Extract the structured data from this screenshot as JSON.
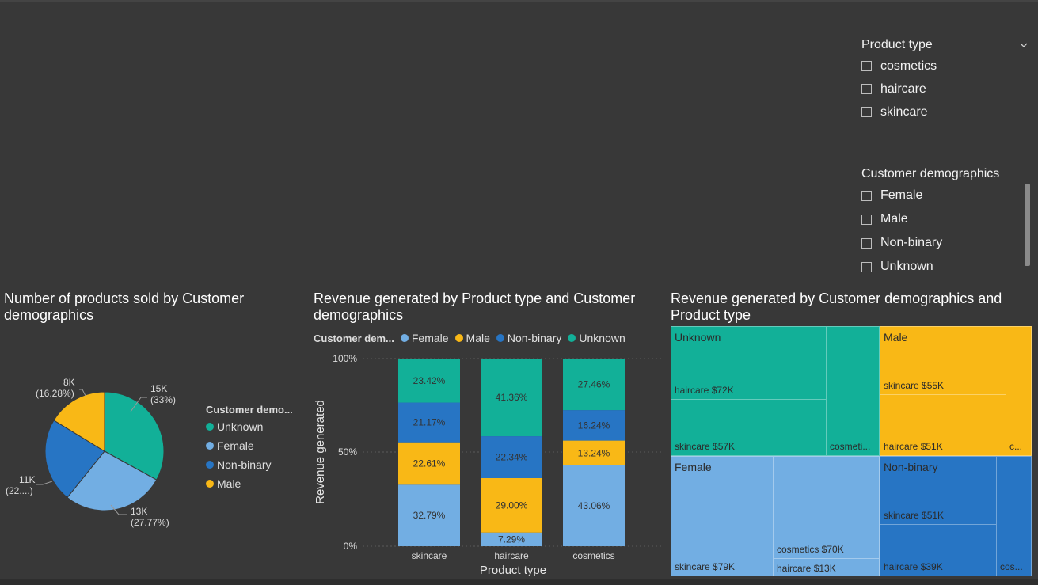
{
  "slicers": {
    "product_type": {
      "title": "Product type",
      "items": [
        "cosmetics",
        "haircare",
        "skincare"
      ]
    },
    "customer_demographics": {
      "title": "Customer demographics",
      "items": [
        "Female",
        "Male",
        "Non-binary",
        "Unknown"
      ]
    }
  },
  "colors": {
    "Unknown": "#12b098",
    "Female": "#72aee3",
    "Non-binary": "#2775c4",
    "Male": "#f9b816",
    "background": "#383838"
  },
  "pie": {
    "title": "Number of products sold by Customer demographics",
    "legend_title": "Customer demo...",
    "legend": [
      "Unknown",
      "Female",
      "Non-binary",
      "Male"
    ],
    "labels": {
      "unknown": [
        "15K",
        "(33%)"
      ],
      "female": [
        "13K",
        "(27.77%)"
      ],
      "nonbinary": [
        "11K",
        "(22....)"
      ],
      "male": [
        "8K",
        "(16.28%)"
      ]
    }
  },
  "stacked": {
    "title": "Revenue generated by Product type and Customer demographics",
    "legend_title": "Customer dem...",
    "legend": [
      "Female",
      "Male",
      "Non-binary",
      "Unknown"
    ],
    "y_axis_label": "Revenue generated",
    "x_axis_label": "Product type",
    "y_ticks": [
      "100%",
      "50%",
      "0%"
    ]
  },
  "treemap": {
    "title": "Revenue generated by Customer demographics and Product type",
    "groups": [
      {
        "name": "Unknown",
        "leaves": [
          "haircare $72K",
          "skincare $57K",
          "cosmeti..."
        ]
      },
      {
        "name": "Male",
        "leaves": [
          "skincare $55K",
          "haircare $51K",
          "c..."
        ]
      },
      {
        "name": "Female",
        "leaves": [
          "skincare $79K",
          "cosmetics $70K",
          "haircare $13K"
        ]
      },
      {
        "name": "Non-binary",
        "leaves": [
          "skincare $51K",
          "haircare $39K",
          "cos..."
        ]
      }
    ]
  },
  "chart_data": [
    {
      "type": "pie",
      "title": "Number of products sold by Customer demographics",
      "categories": [
        "Unknown",
        "Female",
        "Non-binary",
        "Male"
      ],
      "values": [
        15000,
        13000,
        11000,
        8000
      ],
      "percent": [
        33.0,
        27.77,
        22.95,
        16.28
      ],
      "legend_title": "Customer demo...",
      "legend_position": "right"
    },
    {
      "type": "bar",
      "stacked": "percent",
      "title": "Revenue generated by Product type and Customer demographics",
      "categories": [
        "skincare",
        "haircare",
        "cosmetics"
      ],
      "xlabel": "Product type",
      "ylabel": "Revenue generated",
      "ylim": [
        0,
        100
      ],
      "series": [
        {
          "name": "Female",
          "values": [
            32.79,
            7.29,
            43.06
          ],
          "labels": [
            "32.79%",
            "7.29%",
            "43.06%"
          ]
        },
        {
          "name": "Male",
          "values": [
            22.61,
            29.0,
            13.24
          ],
          "labels": [
            "22.61%",
            "29.00%",
            "13.24%"
          ]
        },
        {
          "name": "Non-binary",
          "values": [
            21.17,
            22.34,
            16.24
          ],
          "labels": [
            "21.17%",
            "22.34%",
            "16.24%"
          ]
        },
        {
          "name": "Unknown",
          "values": [
            23.42,
            41.36,
            27.46
          ],
          "labels": [
            "23.42%",
            "41.36%",
            "27.46%"
          ]
        }
      ],
      "legend_position": "top"
    },
    {
      "type": "treemap",
      "title": "Revenue generated by Customer demographics and Product type",
      "groups": [
        {
          "name": "Unknown",
          "items": [
            {
              "name": "haircare",
              "value": 72000
            },
            {
              "name": "skincare",
              "value": 57000
            },
            {
              "name": "cosmetics",
              "value": null
            }
          ]
        },
        {
          "name": "Male",
          "items": [
            {
              "name": "skincare",
              "value": 55000
            },
            {
              "name": "haircare",
              "value": 51000
            },
            {
              "name": "cosmetics",
              "value": null
            }
          ]
        },
        {
          "name": "Female",
          "items": [
            {
              "name": "skincare",
              "value": 79000
            },
            {
              "name": "cosmetics",
              "value": 70000
            },
            {
              "name": "haircare",
              "value": 13000
            }
          ]
        },
        {
          "name": "Non-binary",
          "items": [
            {
              "name": "skincare",
              "value": 51000
            },
            {
              "name": "haircare",
              "value": 39000
            },
            {
              "name": "cosmetics",
              "value": null
            }
          ]
        }
      ]
    }
  ]
}
